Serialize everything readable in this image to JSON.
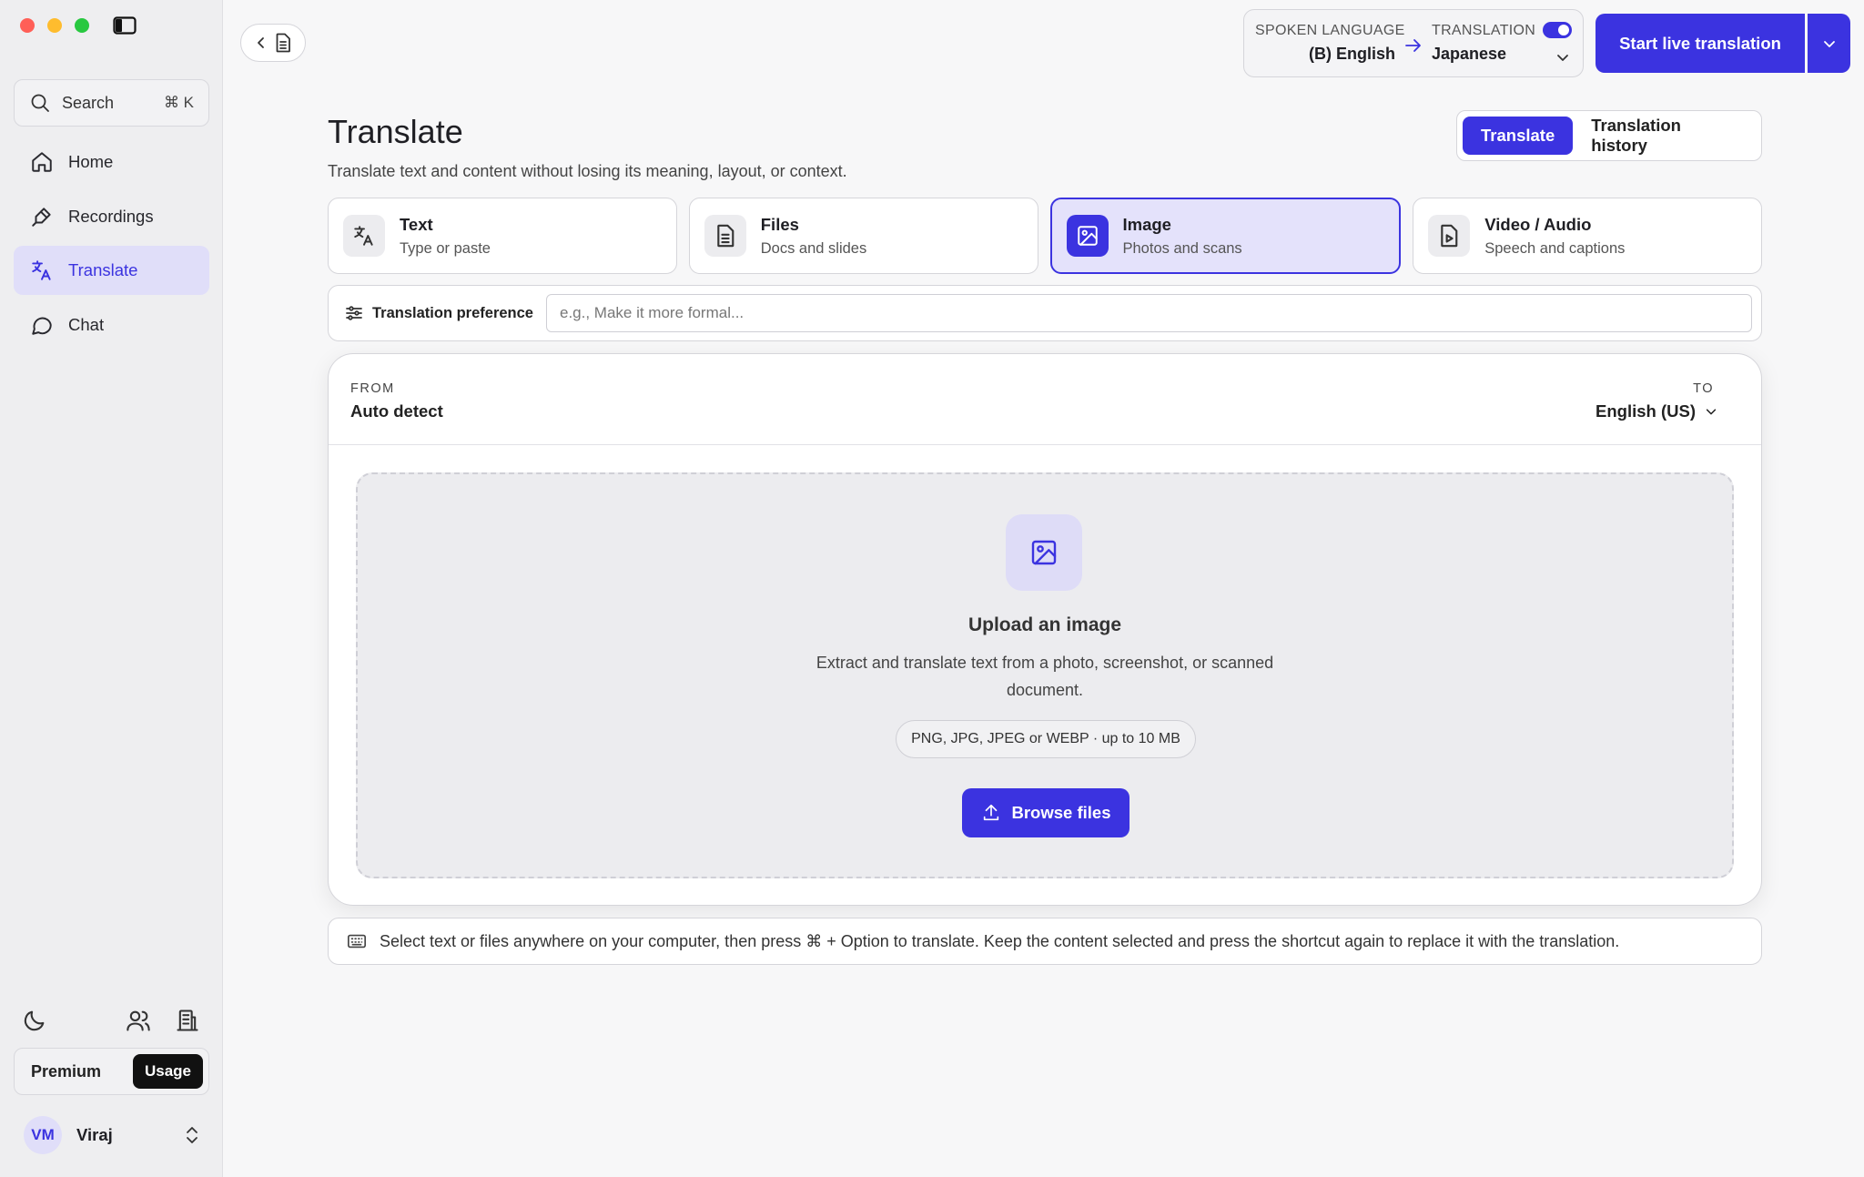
{
  "sidebar": {
    "search": {
      "label": "Search",
      "shortcut": "⌘ K"
    },
    "items": [
      {
        "label": "Home",
        "icon": "home-icon"
      },
      {
        "label": "Recordings",
        "icon": "recordings-icon"
      },
      {
        "label": "Translate",
        "icon": "translate-icon",
        "active": true
      },
      {
        "label": "Chat",
        "icon": "chat-icon"
      }
    ],
    "plan": {
      "label": "Premium",
      "usage": "Usage"
    },
    "user": {
      "initials": "VM",
      "name": "Viraj"
    }
  },
  "topbar": {
    "spoken_label": "SPOKEN LANGUAGE",
    "spoken_value": "(B) English",
    "translation_label": "TRANSLATION",
    "translation_value": "Japanese",
    "translation_enabled": true,
    "live_button": "Start live translation"
  },
  "main": {
    "title": "Translate",
    "subtitle": "Translate text and content without losing its meaning, layout, or context.",
    "segments": {
      "translate": "Translate",
      "history": "Translation history"
    },
    "modes": [
      {
        "title": "Text",
        "sub": "Type or paste",
        "icon": "translate-icon"
      },
      {
        "title": "Files",
        "sub": "Docs and slides",
        "icon": "document-icon"
      },
      {
        "title": "Image",
        "sub": "Photos and scans",
        "icon": "image-icon",
        "selected": true
      },
      {
        "title": "Video / Audio",
        "sub": "Speech and captions",
        "icon": "video-file-icon"
      }
    ],
    "preference": {
      "label": "Translation preference",
      "placeholder": "e.g., Make it more formal..."
    },
    "panel": {
      "from_label": "FROM",
      "from_value": "Auto detect",
      "to_label": "TO",
      "to_value": "English (US)",
      "upload_title": "Upload an image",
      "upload_desc": "Extract and translate text from a photo, screenshot, or scanned document.",
      "formats": "PNG, JPG, JPEG or WEBP · up to 10 MB",
      "browse": "Browse files"
    },
    "hint": "Select text or files anywhere on your computer, then press ⌘ + Option to translate. Keep the content selected and press the shortcut again to replace it with the translation."
  },
  "colors": {
    "accent": "#3b33e0",
    "accent_soft": "#e0def9",
    "sidebar_bg": "#eeeef0"
  }
}
